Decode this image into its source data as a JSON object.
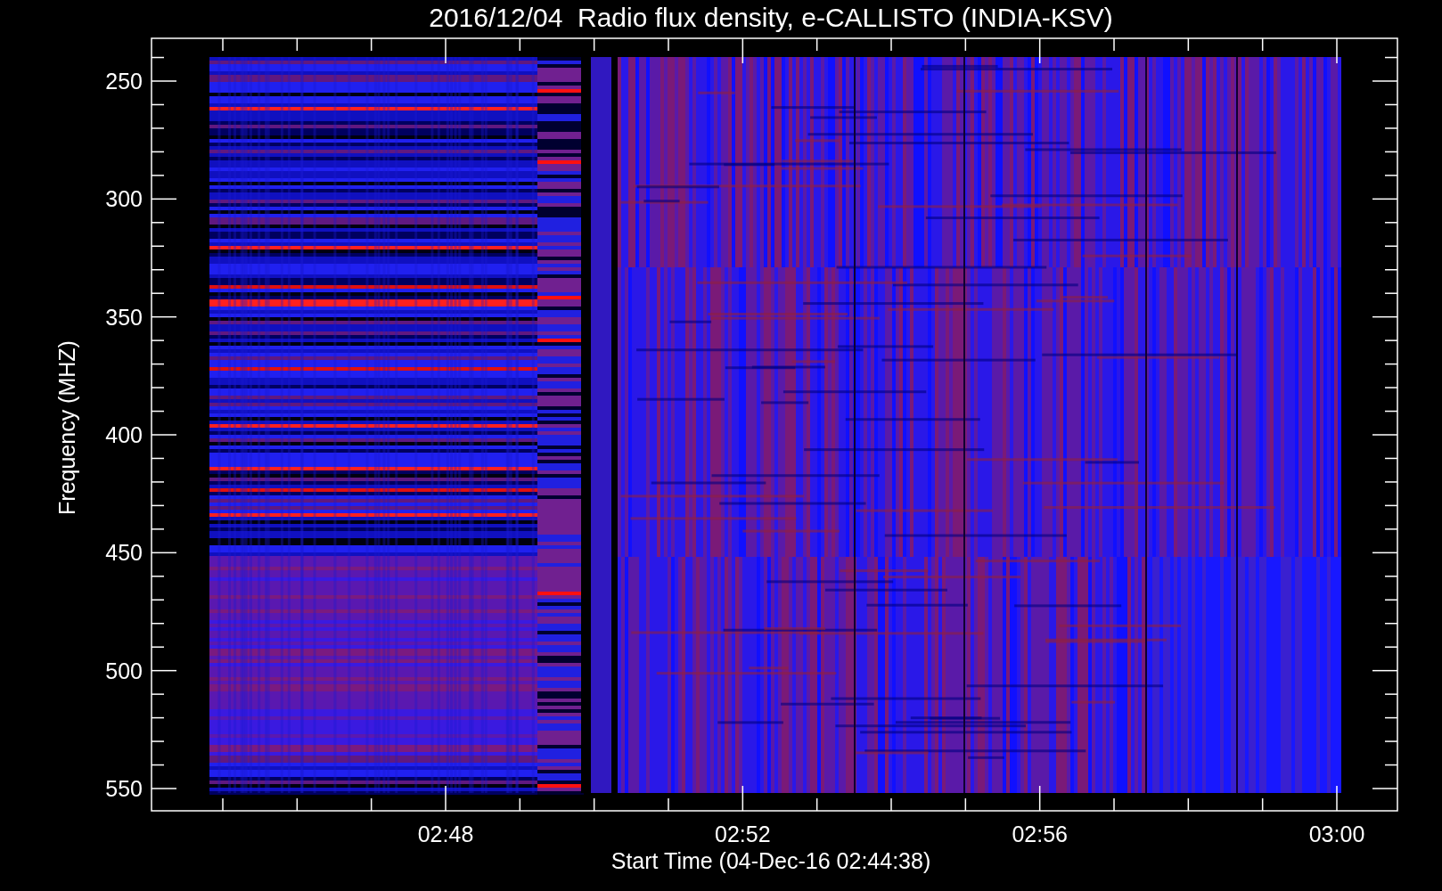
{
  "title": "2016/12/04  Radio flux density, e-CALLISTO (INDIA-KSV)",
  "y_axis": {
    "label": "Frequency (MHZ)",
    "ticks": [
      "250",
      "300",
      "350",
      "400",
      "450",
      "500",
      "550"
    ]
  },
  "x_axis": {
    "label": "Start Time (04-Dec-16 02:44:38)",
    "ticks": [
      "02:48",
      "02:52",
      "02:56",
      "03:00"
    ]
  }
}
